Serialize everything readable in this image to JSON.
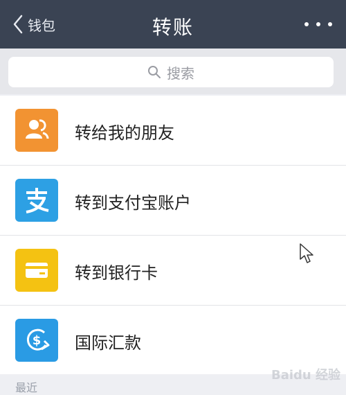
{
  "nav": {
    "back_label": "钱包",
    "title": "转账"
  },
  "search": {
    "placeholder": "搜索"
  },
  "items": [
    {
      "label": "转给我的朋友",
      "icon": "friend-icon",
      "color": "#f29332"
    },
    {
      "label": "转到支付宝账户",
      "icon": "alipay-icon",
      "color": "#2da0e4"
    },
    {
      "label": "转到银行卡",
      "icon": "bank-card-icon",
      "color": "#f4c212"
    },
    {
      "label": "国际汇款",
      "icon": "international-remittance-icon",
      "color": "#2a9be4"
    }
  ],
  "section": {
    "label": "最近"
  },
  "watermark": "Baidu 经验"
}
